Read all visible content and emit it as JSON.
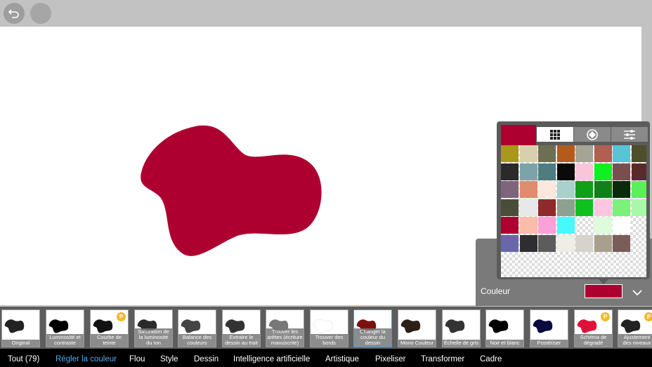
{
  "top_bar": {
    "back_icon": "undo-arrow-icon",
    "second_icon": "blank-circle-button"
  },
  "shape": {
    "fill_color": "#ae0030"
  },
  "palette": {
    "current_color": "#ae0030",
    "tabs": [
      {
        "icon": "grid-icon",
        "active": true
      },
      {
        "icon": "color-wheel-icon",
        "active": false
      },
      {
        "icon": "sliders-icon",
        "active": false
      }
    ],
    "colors": [
      "#a89a18",
      "#d8cfae",
      "#6e6e52",
      "#b45a1a",
      "#a6a496",
      "#b06050",
      "#5ac4d6",
      "#4e4e2a",
      "#2a2a2a",
      "#7aa4a8",
      "#4e7c80",
      "#0a0a0a",
      "#f8c6d8",
      "#10f020",
      "#7a4e4e",
      "#5a2a2a",
      "#80647c",
      "#e08c70",
      "#fce8dc",
      "#a8d0cc",
      "#10a018",
      "#108018",
      "#0a2a0a",
      "#5af05a",
      "#4a4e38",
      "#e8e8e8",
      "#902a2a",
      "#8ea090",
      "#10c020",
      "#fcc6e0",
      "#7cf07c",
      "#a8f8a8",
      "#ae0030",
      "#fcbcaa",
      "#fca0d8",
      "#48f8fc",
      "#transparent",
      "#dcfcdc",
      "#ffffff",
      "#transparent",
      "#6868a8",
      "#2e2e30",
      "#5c5c5c",
      "#f0ece6",
      "#d8d2cc",
      "#a8a08e",
      "#7a5c5a",
      "#transparent"
    ]
  },
  "color_panel": {
    "label": "Couleur",
    "selected_color": "#ae0030"
  },
  "filters": [
    {
      "name": "Original",
      "thumb_color": "#222222",
      "premium": false,
      "selected": false
    },
    {
      "name": "Luminosité et contraste",
      "thumb_color": "#000000",
      "premium": false,
      "selected": false
    },
    {
      "name": "Courbe de teinte",
      "thumb_color": "#111111",
      "premium": true,
      "selected": false
    },
    {
      "name": "Saturation de la luminosité du ton",
      "thumb_color": "#2a2a2a",
      "premium": false,
      "selected": false
    },
    {
      "name": "Balance des couleurs",
      "thumb_color": "#444444",
      "premium": false,
      "selected": false
    },
    {
      "name": "Extraire le dessin au trait",
      "thumb_color": "#333333",
      "premium": false,
      "selected": false
    },
    {
      "name": "Trouver les arêtes (écriture manuscrite)",
      "thumb_color": "#777777",
      "premium": false,
      "selected": false
    },
    {
      "name": "Trouver des bords",
      "thumb_color": "#ffffff",
      "premium": false,
      "selected": false
    },
    {
      "name": "Changer la couleur du dessin",
      "thumb_color": "#7a1010",
      "premium": false,
      "selected": true
    },
    {
      "name": "Mono Couleur",
      "thumb_color": "#2a2018",
      "premium": false,
      "selected": false
    },
    {
      "name": "Échelle de gris",
      "thumb_color": "#333333",
      "premium": false,
      "selected": false
    },
    {
      "name": "Noir et blanc",
      "thumb_color": "#000000",
      "premium": false,
      "selected": false
    },
    {
      "name": "Postériser",
      "thumb_color": "#0a0a40",
      "premium": false,
      "selected": false
    },
    {
      "name": "Schéma de dégradé",
      "thumb_color": "#e0103a",
      "premium": true,
      "selected": false
    },
    {
      "name": "Ajustement des niveaux",
      "thumb_color": "#222222",
      "premium": true,
      "selected": false
    }
  ],
  "premium_badge": "P",
  "categories": [
    {
      "label": "Tout (79)",
      "active": false
    },
    {
      "label": "Régler la couleur",
      "active": true
    },
    {
      "label": "Flou",
      "active": false
    },
    {
      "label": "Style",
      "active": false
    },
    {
      "label": "Dessin",
      "active": false
    },
    {
      "label": "Intelligence artificielle",
      "active": false
    },
    {
      "label": "Artistique",
      "active": false
    },
    {
      "label": "Pixeliser",
      "active": false
    },
    {
      "label": "Transformer",
      "active": false
    },
    {
      "label": "Cadre",
      "active": false
    }
  ]
}
